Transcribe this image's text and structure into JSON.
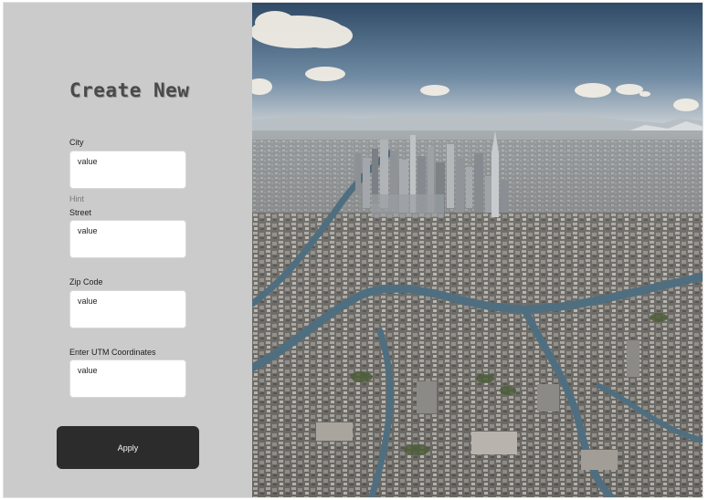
{
  "form": {
    "title": "Create New",
    "fields": [
      {
        "label": "City",
        "value": "value"
      },
      {
        "label": "Street",
        "value": "value"
      },
      {
        "label": "Zip Code",
        "value": "value"
      },
      {
        "label": "Enter UTM Coordinates",
        "value": "value"
      }
    ],
    "hint": "Hint",
    "apply_label": "Apply"
  },
  "colors": {
    "panel_background": "#cbcbcb",
    "button_background": "#2c2c2c",
    "button_text": "#f5f5f5",
    "field_background": "#ffffff"
  },
  "image": {
    "subject": "aerial-city-photo"
  }
}
